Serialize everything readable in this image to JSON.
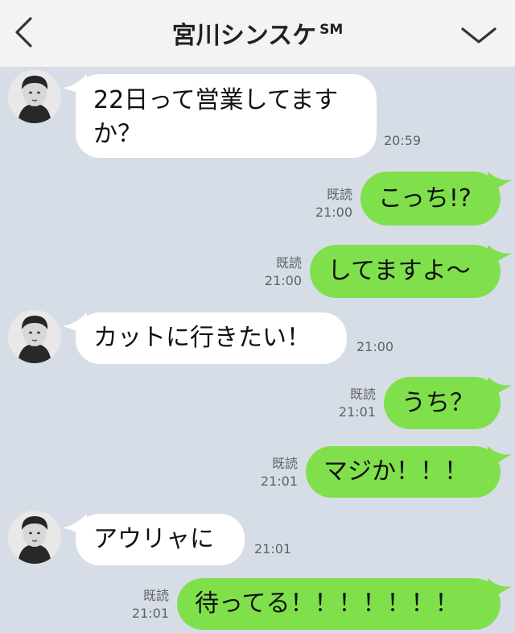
{
  "header": {
    "title": "宮川シンスケ",
    "title_sup": "SM",
    "back_icon": "chevron-left-icon",
    "more_icon": "chevron-down-icon"
  },
  "messages": [
    {
      "direction": "in",
      "avatar": "user-avatar",
      "text_line1": "22日って営業してます",
      "text_line2": "か？",
      "time": "20:59"
    },
    {
      "direction": "out",
      "read": "既読",
      "time": "21:00",
      "text": "こっち!?"
    },
    {
      "direction": "out",
      "read": "既読",
      "time": "21:00",
      "text": "してますよ〜"
    },
    {
      "direction": "in",
      "avatar": "user-avatar",
      "text": "カットに行きたい！",
      "time": "21:00"
    },
    {
      "direction": "out",
      "read": "既読",
      "time": "21:01",
      "text": "うち？"
    },
    {
      "direction": "out",
      "read": "既読",
      "time": "21:01",
      "text": "マジか！！！"
    },
    {
      "direction": "in",
      "avatar": "user-avatar",
      "text": "アウリャに",
      "time": "21:01"
    },
    {
      "direction": "out",
      "read": "既読",
      "time": "21:01",
      "text": "待ってる！！！！！！！"
    }
  ],
  "colors": {
    "background": "#d7dde6",
    "header": "#f3f3f3",
    "incoming": "#ffffff",
    "outgoing": "#7fe04c",
    "meta_text": "#5f6268"
  }
}
